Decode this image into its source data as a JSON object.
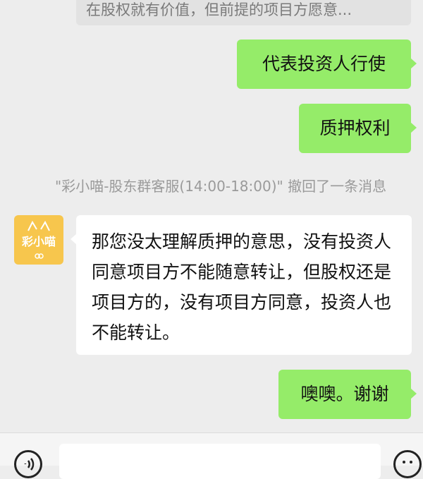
{
  "chat": {
    "quoted_preview": "在股权就有价值，但前提的项目方愿意...",
    "messages_out_1": "代表投资人行使",
    "messages_out_2": "质押权利",
    "recall_notice": "\"彩小喵-股东群客服(14:00-18:00)\" 撤回了一条消息",
    "contact_avatar_text": "彩小喵",
    "message_in_1": "那您没太理解质押的意思，没有投资人同意项目方不能随意转让，但股权还是项目方的，没有项目方同意，投资人也不能转让。",
    "messages_out_3": "噢噢。谢谢"
  },
  "colors": {
    "outgoing_bubble": "#95ec69",
    "incoming_bubble": "#ffffff",
    "background": "#ededed",
    "avatar_bg": "#f7c64d"
  },
  "icons": {
    "voice": "voice-icon",
    "emoji": "emoji-icon"
  }
}
